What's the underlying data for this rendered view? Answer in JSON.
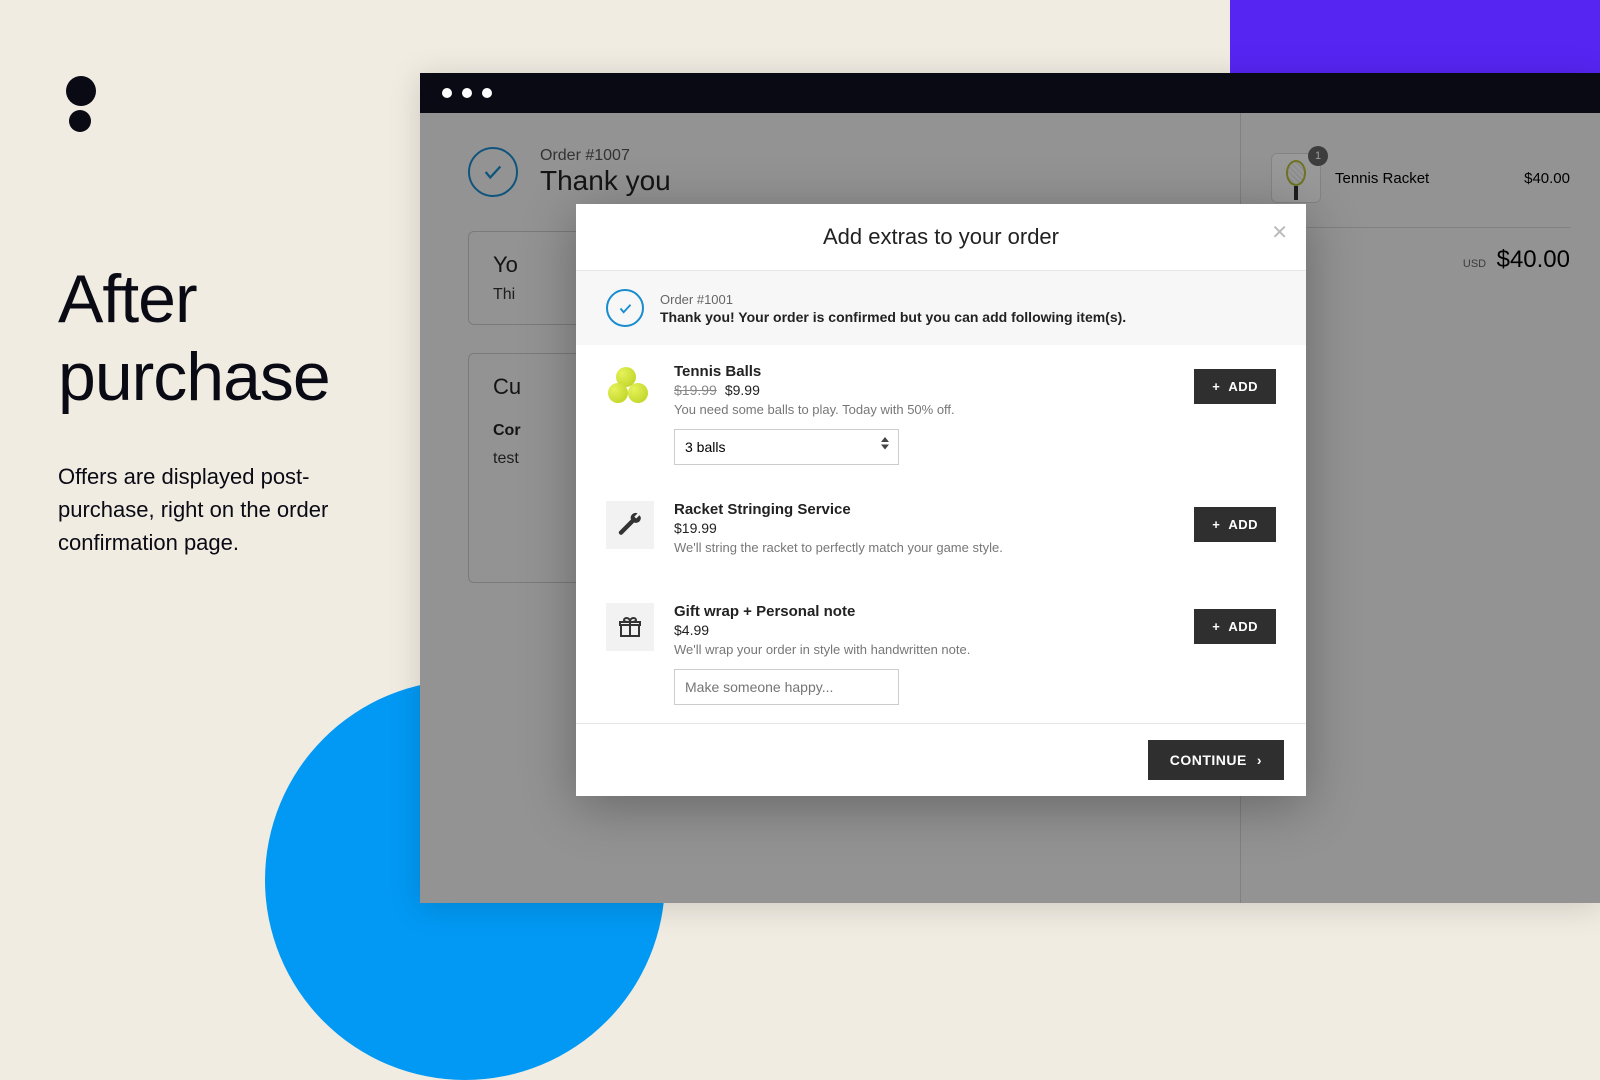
{
  "heading": {
    "title_line1": "After",
    "title_line2": "purchase",
    "subtitle": "Offers are displayed post-purchase, right on the order confirmation page."
  },
  "order": {
    "number": "Order #1007",
    "thanks": "Thank you"
  },
  "panels": {
    "p1_title": "Yo",
    "p1_sub": "Thi",
    "p2_title": "Cu",
    "p2_bold": "Cor",
    "p2_body": "test"
  },
  "cart": {
    "item_name": "Tennis Racket",
    "item_price": "$40.00",
    "qty": "1",
    "currency": "USD",
    "total": "$40.00"
  },
  "modal": {
    "title": "Add extras to your order",
    "order_num": "Order #1001",
    "confirm_msg": "Thank you! Your order is confirmed but you can add following item(s).",
    "continue": "CONTINUE",
    "add": "ADD"
  },
  "extras": [
    {
      "icon": "balls",
      "title": "Tennis Balls",
      "strike": "$19.99",
      "price": "$9.99",
      "desc": "You need some balls to play. Today with 50% off.",
      "select": "3 balls"
    },
    {
      "icon": "wrench",
      "title": "Racket Stringing Service",
      "price": "$19.99",
      "desc": "We'll string the racket to perfectly match your game style."
    },
    {
      "icon": "gift",
      "title": "Gift wrap + Personal note",
      "price": "$4.99",
      "desc": "We'll wrap your order in style with handwritten note.",
      "placeholder": "Make someone happy..."
    }
  ]
}
